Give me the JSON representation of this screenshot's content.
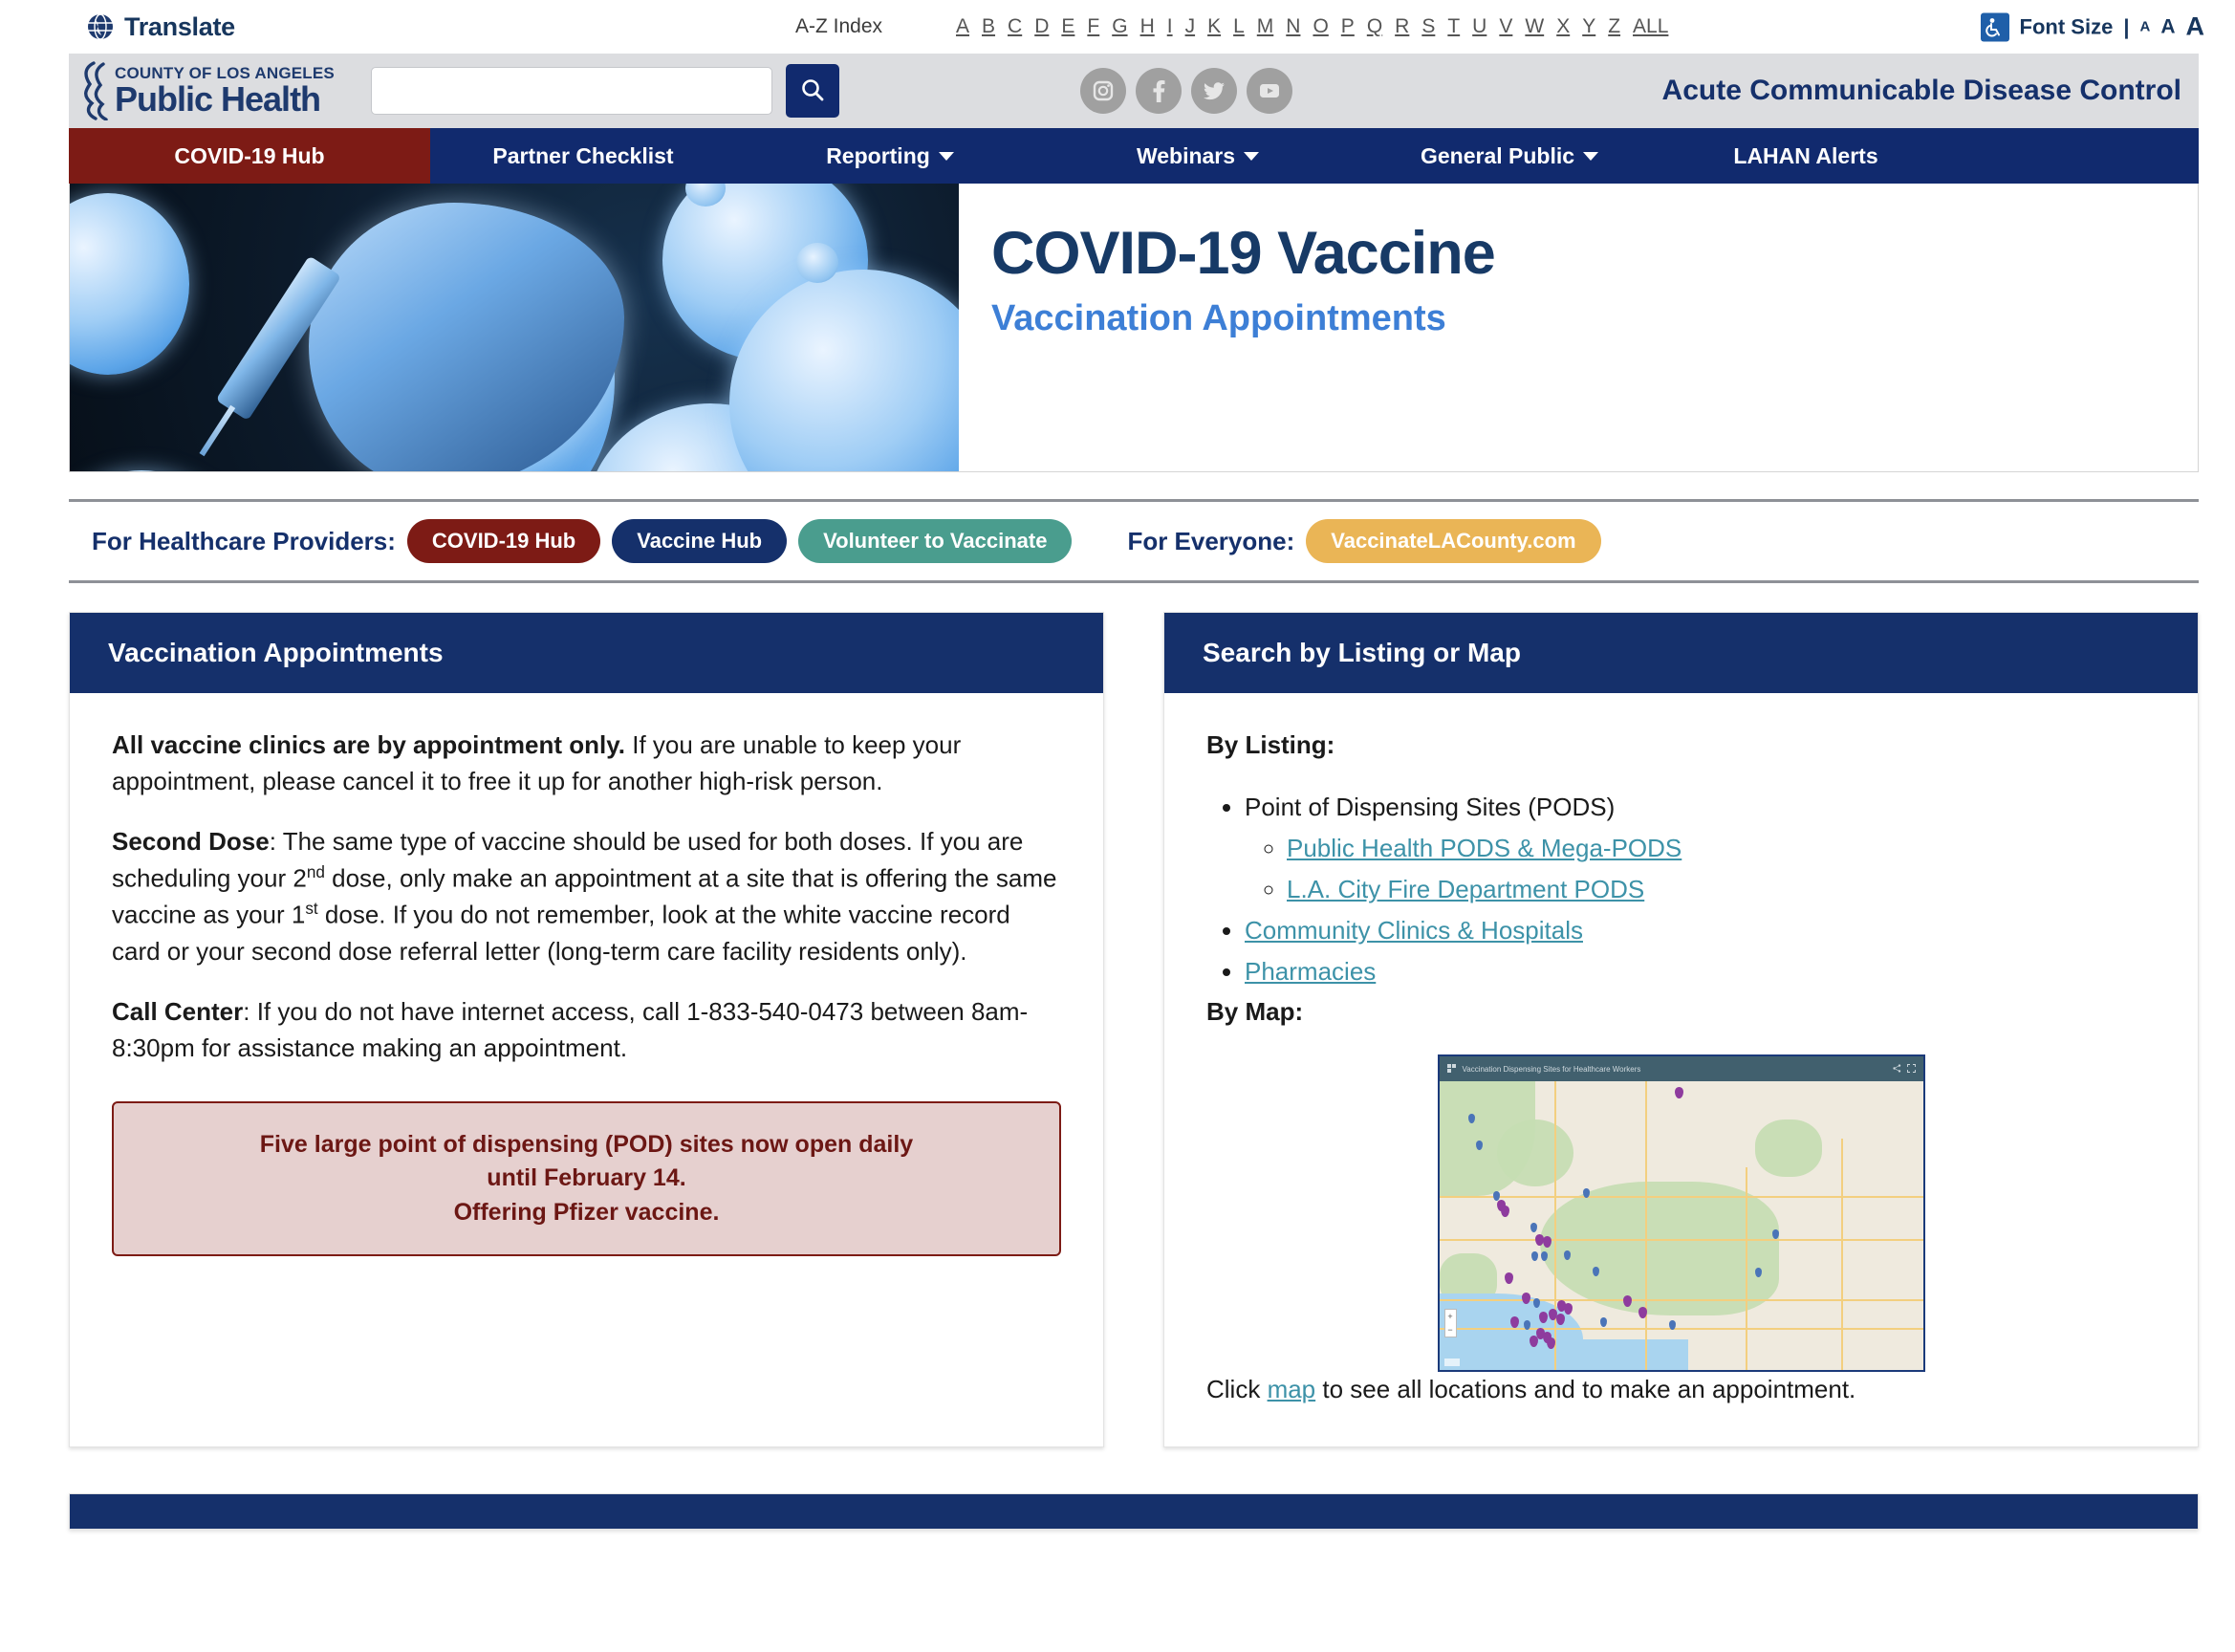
{
  "utility": {
    "translate_label": "Translate",
    "translate_icon": "globe-icon",
    "az_index_label": "A-Z Index",
    "az_letters": [
      "A",
      "B",
      "C",
      "D",
      "E",
      "F",
      "G",
      "H",
      "I",
      "J",
      "K",
      "L",
      "M",
      "N",
      "O",
      "P",
      "Q",
      "R",
      "S",
      "T",
      "U",
      "V",
      "W",
      "X",
      "Y",
      "Z",
      "ALL"
    ],
    "accessibility_icon": "wheelchair-accessibility-icon",
    "font_size_label": "Font Size",
    "font_size_pipe": "|",
    "font_size_small": "A",
    "font_size_medium": "A",
    "font_size_large": "A"
  },
  "header": {
    "logo_line1": "County of Los Angeles",
    "logo_line2": "Public Health",
    "logo_icon": "la-county-public-health-logo",
    "search_placeholder": "",
    "search_value": "",
    "search_icon": "search-icon",
    "socials": [
      {
        "name": "instagram-icon",
        "glyph": "◎"
      },
      {
        "name": "facebook-icon",
        "glyph": "f"
      },
      {
        "name": "twitter-icon",
        "glyph": "ᵗ"
      },
      {
        "name": "youtube-icon",
        "glyph": "You"
      }
    ],
    "department_title": "Acute Communicable Disease Control"
  },
  "nav": {
    "items": [
      {
        "label": "COVID-19 Hub",
        "active": true,
        "has_caret": false
      },
      {
        "label": "Partner Checklist",
        "active": false,
        "has_caret": false
      },
      {
        "label": "Reporting",
        "active": false,
        "has_caret": true
      },
      {
        "label": "Webinars",
        "active": false,
        "has_caret": true
      },
      {
        "label": "General Public",
        "active": false,
        "has_caret": true
      },
      {
        "label": "LAHAN Alerts",
        "active": false,
        "has_caret": false
      }
    ]
  },
  "hero": {
    "image_name": "covid-vaccine-syringe-virus-banner",
    "title": "COVID-19 Vaccine",
    "subtitle": "Vaccination Appointments"
  },
  "providers_bar": {
    "providers_label": "For Healthcare Providers:",
    "pills": [
      {
        "label": "COVID-19 Hub",
        "color": "#7d1b15"
      },
      {
        "label": "Vaccine Hub",
        "color": "#15306b"
      },
      {
        "label": "Volunteer to Vaccinate",
        "color": "#4a9d8e"
      }
    ],
    "everyone_label": "For Everyone:",
    "everyone_pill": {
      "label": "VaccinateLACounty.com",
      "color": "#eab556"
    }
  },
  "left_panel": {
    "heading": "Vaccination Appointments",
    "p1_bold": "All vaccine clinics are by appointment only.",
    "p1_rest": " If you are unable to keep your appointment, please cancel it to free it up for another high-risk person.",
    "p2_bold": "Second Dose",
    "p2_a": ": The same type of vaccine should be used for both doses. If you are scheduling your 2",
    "p2_sup1": "nd",
    "p2_b": " dose, only make an appointment at a site that is offering the same vaccine as your 1",
    "p2_sup2": "st",
    "p2_c": " dose. If you do not remember, look at the white vaccine record card or your second dose referral letter (long-term care facility residents only).",
    "p3_bold": "Call Center",
    "p3_rest": ": If you do not have internet access, call 1-833-540-0473 between 8am-8:30pm for assistance making an appointment.",
    "alert_line1": "Five large point of dispensing (POD) sites now open daily",
    "alert_line2": "until February 14.",
    "alert_line3": "Offering Pfizer vaccine.",
    "alert_border_color": "#7d1b15",
    "alert_bg_color": "#e6d0cf"
  },
  "right_panel": {
    "heading": "Search by Listing or Map",
    "by_listing_label": "By Listing:",
    "listing": {
      "pods_label": "Point of Dispensing Sites (PODS)",
      "pods_sublinks": [
        "Public Health PODS & Mega-PODS",
        "L.A. City Fire Department PODS"
      ],
      "links": [
        "Community Clinics & Hospitals",
        "Pharmacies"
      ]
    },
    "by_map_label": "By Map:",
    "map_image_name": "vaccination-dispensing-sites-map-thumbnail",
    "map_window_title": "Vaccination Dispensing Sites for Healthcare Workers",
    "map_zoom_in": "+",
    "map_zoom_out": "−",
    "caption_pre": "Click ",
    "caption_link": "map",
    "caption_post": " to see all locations and to make an appointment."
  },
  "theme": {
    "navy": "#15306b",
    "dark_navy": "#112a6e",
    "maroon": "#7d1b15",
    "teal": "#4a9d8e",
    "gold": "#eab556",
    "link_teal": "#3d92a8",
    "header_grey": "#dcdde0"
  }
}
